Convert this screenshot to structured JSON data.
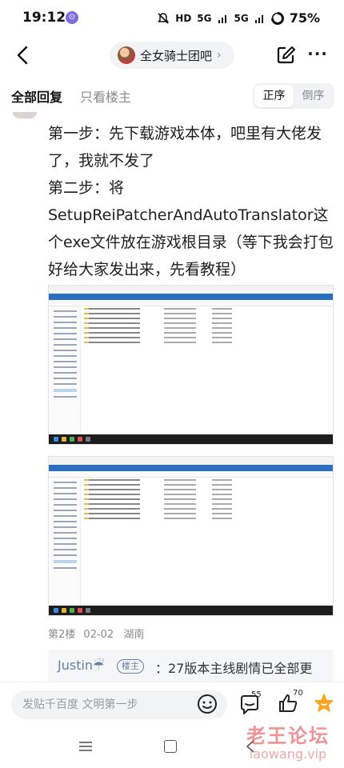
{
  "status_bar": {
    "time": "19:12",
    "notification": "⊙",
    "icons_text": [
      "HD",
      "5G",
      "5G"
    ],
    "battery": "75%"
  },
  "nav": {
    "forum_name": "全女骑士团吧",
    "chevron": "›",
    "more": "···"
  },
  "tabs": {
    "all_replies": "全部回复",
    "owner_only": "只看楼主",
    "sort_asc": "正序",
    "sort_desc": "倒序"
  },
  "post": {
    "lines": [
      "第一步：先下载游戏本体，吧里有大佬发了，我就不发了",
      "第二步：将SetupReiPatcherAndAutoTranslator这个exe文件放在游戏根目录（等下我会打包好给大家发出来，先看教程）"
    ],
    "floor": "第2楼",
    "date": "02-02",
    "location": "湖南"
  },
  "reply_preview": {
    "user": "Justin☔",
    "badge": "楼主",
    "text": "：27版本主线剧情已全部更"
  },
  "bottom_bar": {
    "input_placeholder": "发贴千百度 文明第一步",
    "comment_count": "55",
    "like_count": "70"
  },
  "watermark": {
    "title": "老王论坛",
    "url": "laowang.vip"
  },
  "colors": {
    "accent_link": "#6a7fa6",
    "star": "#f5a623",
    "watermark": "#de3c3c"
  }
}
